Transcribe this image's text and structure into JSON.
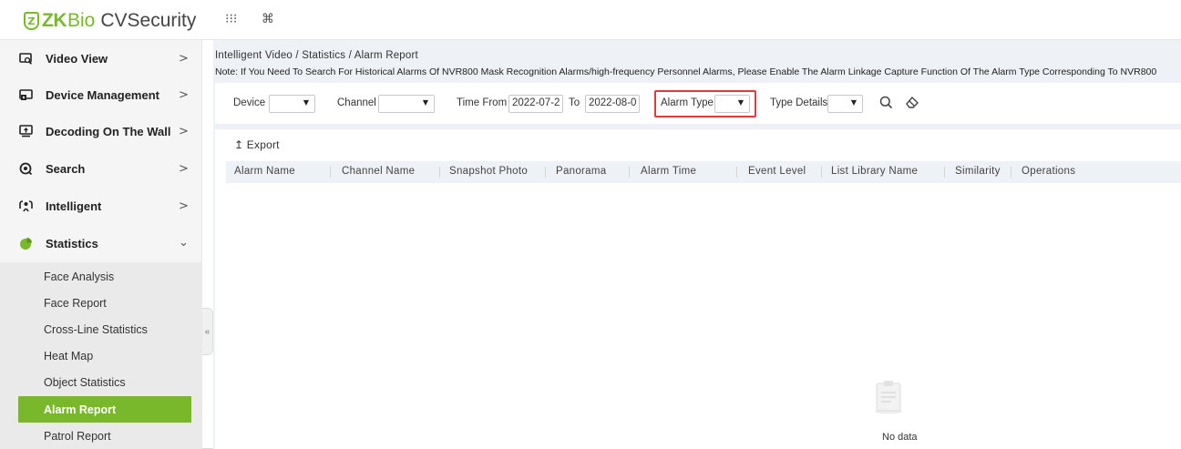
{
  "app": {
    "logo_mark": "Z",
    "logo_zk": "ZK",
    "logo_bio": "Bio",
    "logo_product": "CVSecurity",
    "apps_icon": "grid-apps-icon",
    "cmd_icon": "command-icon",
    "brand_color": "#78b82a"
  },
  "sidebar": {
    "items": [
      {
        "label": "Video View",
        "icon": "video-view-icon",
        "arrow": ">"
      },
      {
        "label": "Device Management",
        "icon": "device-management-icon",
        "arrow": ">"
      },
      {
        "label": "Decoding On The Wall",
        "icon": "decoding-wall-icon",
        "arrow": ">"
      },
      {
        "label": "Search",
        "icon": "search-menu-icon",
        "arrow": ">"
      },
      {
        "label": "Intelligent",
        "icon": "intelligent-icon",
        "arrow": ">"
      },
      {
        "label": "Statistics",
        "icon": "statistics-icon",
        "arrow": "⌄"
      }
    ],
    "subitems": [
      {
        "label": "Face Analysis"
      },
      {
        "label": "Face Report"
      },
      {
        "label": "Cross-Line Statistics"
      },
      {
        "label": "Heat Map"
      },
      {
        "label": "Object Statistics"
      },
      {
        "label": "Alarm Report",
        "active": true
      },
      {
        "label": "Patrol Report"
      }
    ],
    "collapse_glyph": "«"
  },
  "main": {
    "breadcrumb": "Intelligent Video / Statistics / Alarm Report",
    "note": "Note: If You Need To Search For Historical Alarms Of NVR800 Mask Recognition Alarms/high-frequency Personnel Alarms, Please Enable The Alarm Linkage Capture Function Of The Alarm Type Corresponding To NVR800",
    "filters": {
      "device_label": "Device",
      "channel_label": "Channel",
      "time_from_label": "Time From",
      "time_from_value": "2022-07-2",
      "to_label": "To",
      "to_value": "2022-08-0",
      "alarm_type_label": "Alarm Type",
      "type_details_label": "Type Details",
      "caret": "▼",
      "search_glyph": "🔍",
      "clear_glyph": "⌫"
    },
    "export_label": "↥ Export",
    "columns": [
      "Alarm Name",
      "Channel Name",
      "Snapshot Photo",
      "Panorama",
      "Alarm Time",
      "Event Level",
      "List Library Name",
      "Similarity",
      "Operations"
    ],
    "no_data": "No data",
    "highlight_color": "#e03b3b"
  }
}
